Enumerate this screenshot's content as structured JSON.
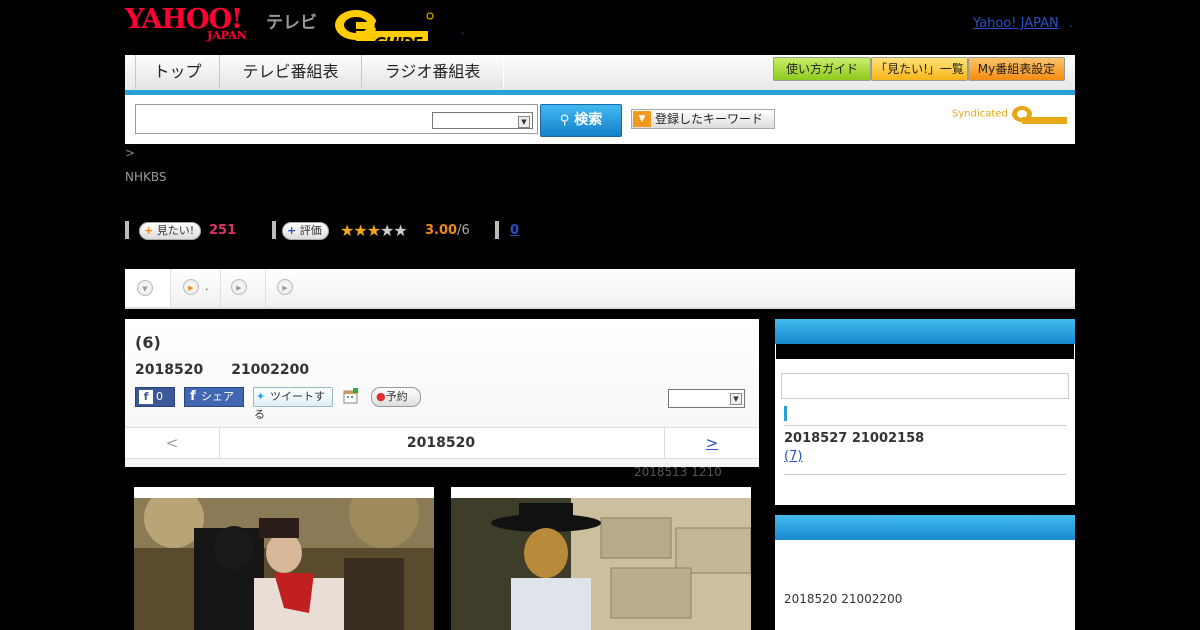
{
  "header": {
    "logo_main": "YAHOO!",
    "logo_sub": "JAPAN",
    "tv_label": "テレビ",
    "gguide_logo": "G GUIDE",
    "sep": ".",
    "yahoo_japan_link": "Yahoo! JAPAN",
    "link_dot": "."
  },
  "nav": {
    "tabs": [
      "トップ",
      "テレビ番組表",
      "ラジオ番組表"
    ],
    "guide_buttons": [
      "使い方ガイド",
      "「見たい!」一覧",
      "My番組表設定"
    ]
  },
  "search": {
    "input_value": "",
    "button_label": "検索",
    "keyword_button": "登録したキーワード",
    "syndicated": "Syndicated"
  },
  "program": {
    "breadcrumb": ">",
    "channel": "NHKBS",
    "mitai_label": "見たい!",
    "mitai_count": "251",
    "rating_label": "評価",
    "stars": "★★★★★",
    "rating_value": "3.00",
    "rating_den": "/6",
    "review_count": "0",
    "title": "(6)",
    "airdate": "2018520　　21002200",
    "fb_like_count": "0",
    "fb_share": "シェア",
    "tweet": "ツイートする",
    "reserve": "予約",
    "date_prev": "<",
    "date_current": "2018520",
    "date_next": ">",
    "previous_airing": "2018513  1210"
  },
  "subtabs": [
    ".",
    "",
    ""
  ],
  "sidebar": {
    "next_airing": "2018527  21002158",
    "next_episode": "(7)",
    "box2_airing": "2018520  21002200"
  },
  "colors": {
    "accent_blue": "#2aa0d6",
    "pink_count": "#e0326e",
    "rating_orange": "#f08a1c"
  }
}
